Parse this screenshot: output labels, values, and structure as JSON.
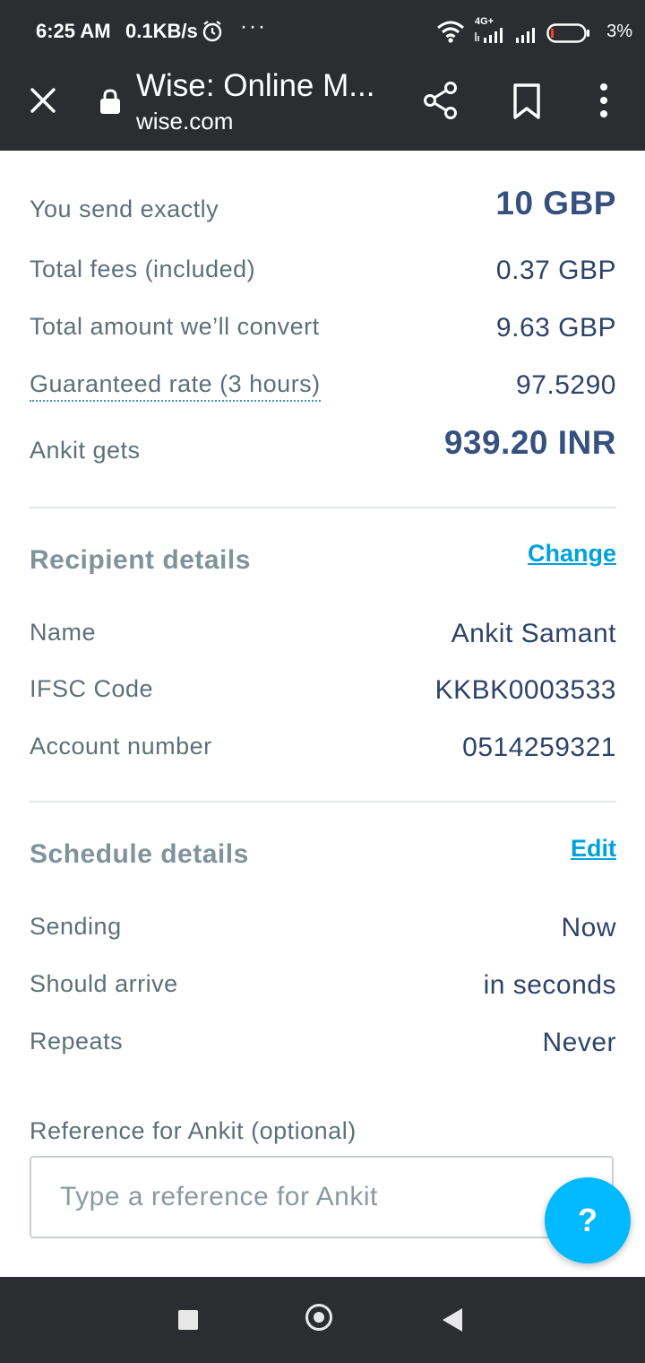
{
  "status_bar": {
    "time": "6:25 AM",
    "speed": "0.1KB/s",
    "dots": "···",
    "network": "4G+",
    "battery": "3%"
  },
  "browser": {
    "title": "Wise: Online M...",
    "url": "wise.com"
  },
  "summary": {
    "send_label": "You send exactly",
    "send_value": "10 GBP",
    "fees_label": "Total fees (included)",
    "fees_value": "0.37 GBP",
    "convert_label": "Total amount we’ll convert",
    "convert_value": "9.63 GBP",
    "rate_label": "Guaranteed rate (3 hours)",
    "rate_value": "97.5290",
    "gets_label": "Ankit gets",
    "gets_value": "939.20 INR"
  },
  "recipient": {
    "title": "Recipient details",
    "change_label": "Change",
    "name_label": "Name",
    "name_value": "Ankit Samant",
    "ifsc_label": "IFSC Code",
    "ifsc_value": "KKBK0003533",
    "account_label": "Account number",
    "account_value": "0514259321"
  },
  "schedule": {
    "title": "Schedule details",
    "edit_label": "Edit",
    "sending_label": "Sending",
    "sending_value": "Now",
    "arrive_label": "Should arrive",
    "arrive_value": "in seconds",
    "repeats_label": "Repeats",
    "repeats_value": "Never"
  },
  "reference": {
    "label": "Reference for Ankit (optional)",
    "placeholder": "Type a reference for Ankit",
    "value": ""
  },
  "help": {
    "label": "?"
  },
  "colors": {
    "accent": "#00b9ff",
    "link": "#00a2dd",
    "value_text": "#2e4369",
    "label_text": "#5d7079"
  }
}
